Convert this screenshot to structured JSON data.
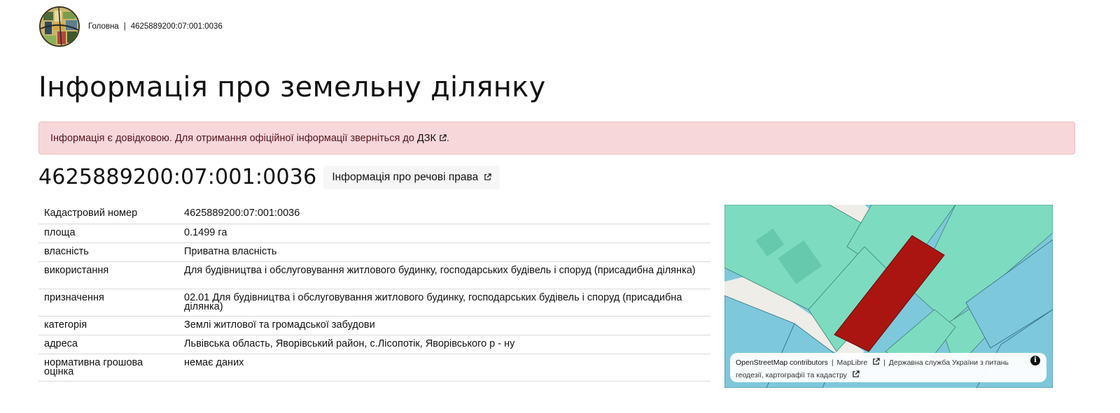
{
  "header": {
    "logo_icon": "cadastre-logo-icon",
    "breadcrumb": {
      "home": "Головна",
      "separator": "|",
      "current": "4625889200:07:001:0036"
    }
  },
  "page_title": "Інформація про земельну ділянку",
  "alert": {
    "text": "Інформація є довідковою. Для отримання офіційної інформації зверніться до",
    "link_label": "ДЗК",
    "suffix": ".",
    "bg_color": "#f8d7da"
  },
  "parcel": {
    "number": "4625889200:07:001:0036",
    "rights_button": "Інформація про речові права"
  },
  "table": {
    "rows": [
      {
        "key": "Кадастровий номер",
        "value": "4625889200:07:001:0036"
      },
      {
        "key": "площа",
        "value": "0.1499 га"
      },
      {
        "key": "власність",
        "value": "Приватна власність"
      },
      {
        "key": "використання",
        "value": "Для будівництва і обслуговування житлового будинку, господарських будівель і споруд (присадибна ділянка)"
      },
      {
        "key": "призначення",
        "value": "02.01 Для будівництва і обслуговування житлового будинку, господарських будівель і споруд (присадибна ділянка)"
      },
      {
        "key": "категорія",
        "value": "Землі житлової та громадської забудови"
      },
      {
        "key": "адреса",
        "value": "Львівська область, Яворівський район, с.Лісопотік, Яворівського р - ну"
      },
      {
        "key": "нормативна грошова оцінка",
        "value": "немає даних"
      }
    ]
  },
  "map": {
    "colors": {
      "parcel": "#aa1511",
      "neighbors": "#7ddcc0",
      "other": "#7ec8dc",
      "roads": "#eeede8"
    },
    "attribution": {
      "osm": "OpenStreetMap contributors",
      "sep": "|",
      "maplibre": "MapLibre",
      "sep2": "|",
      "agency": "Державна служба України з питань геодезії, картографії та кадастру"
    },
    "info_icon": "info-icon"
  }
}
